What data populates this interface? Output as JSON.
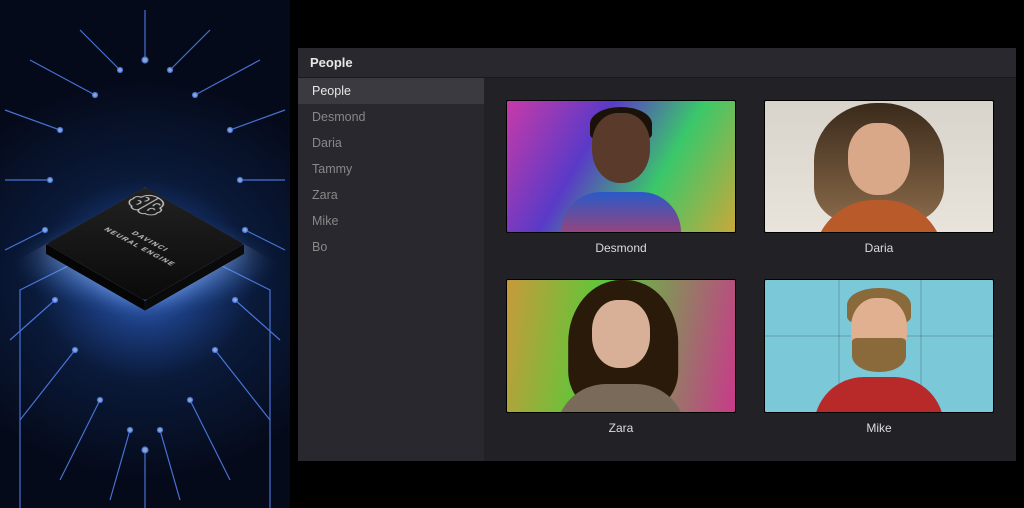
{
  "hero": {
    "chip_brand_line1": "DAVINCI",
    "chip_brand_line2": "NEURAL ENGINE"
  },
  "header": {
    "title": "People"
  },
  "sidebar": {
    "items": [
      {
        "label": "People",
        "selected": true
      },
      {
        "label": "Desmond",
        "selected": false
      },
      {
        "label": "Daria",
        "selected": false
      },
      {
        "label": "Tammy",
        "selected": false
      },
      {
        "label": "Zara",
        "selected": false
      },
      {
        "label": "Mike",
        "selected": false
      },
      {
        "label": "Bo",
        "selected": false
      }
    ]
  },
  "grid": {
    "cards": [
      {
        "name": "Desmond",
        "thumb_class": "thumb-desmond"
      },
      {
        "name": "Daria",
        "thumb_class": "thumb-daria"
      },
      {
        "name": "Zara",
        "thumb_class": "thumb-zara"
      },
      {
        "name": "Mike",
        "thumb_class": "thumb-mike"
      }
    ]
  }
}
